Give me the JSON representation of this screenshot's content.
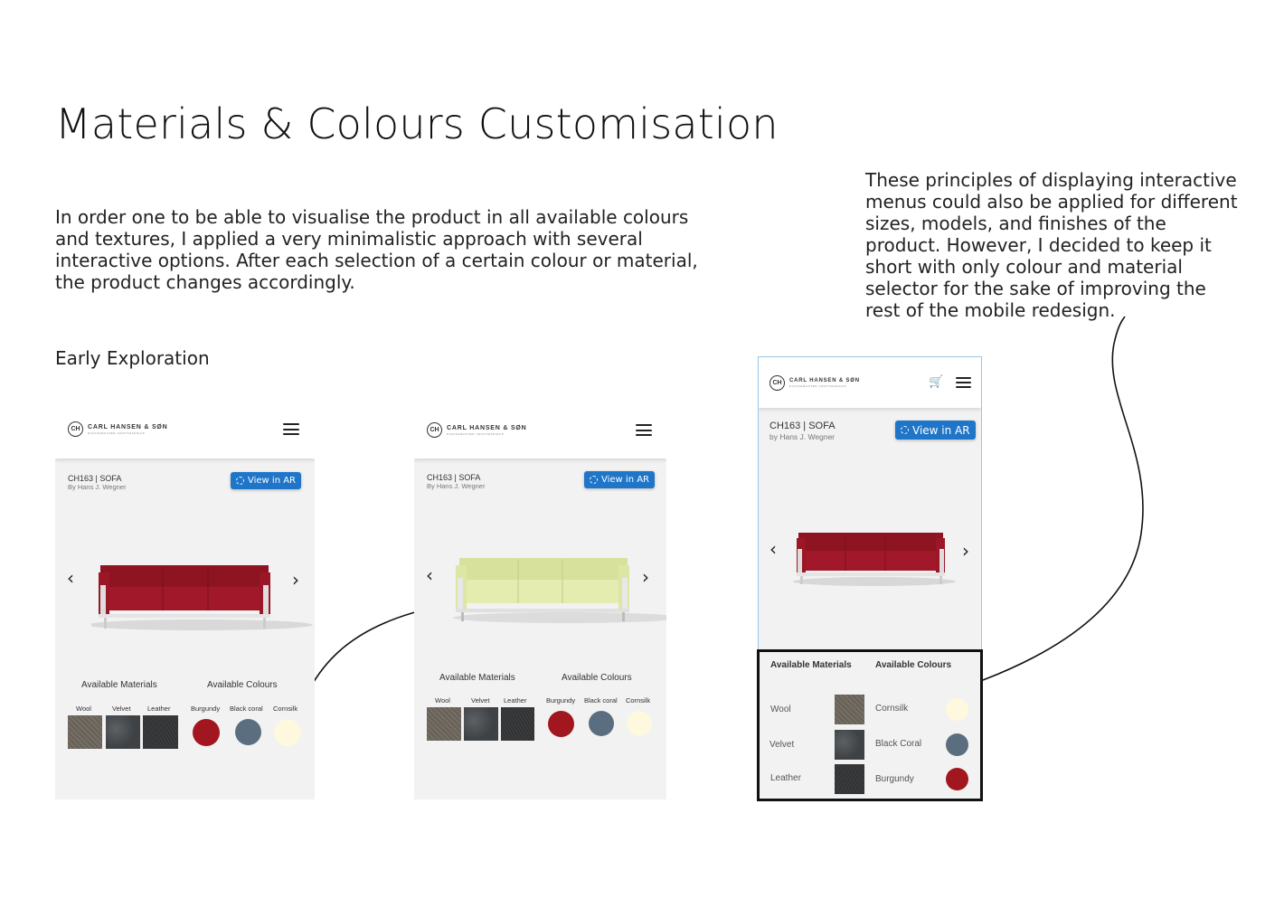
{
  "title": "Materials & Colours Customisation",
  "intro": "In order one to be able to visualise the product in all available colours and textures, I applied a very minimalistic approach with several interactive options. After each selection of a certain colour or material, the product changes accordingly.",
  "side_note": "These principles of displaying interactive menus could also be applied for different sizes, models, and finishes of the product. However, I decided to keep it short with only colour and material selector for the sake of improving the rest of the mobile redesign.",
  "section_label": "Early Exploration",
  "brand": {
    "name": "CARL HANSEN & SØN",
    "tagline": "DANISHMASTER CRAFTMANSHIP",
    "logo_text": "CH"
  },
  "product": {
    "name_small": "CH163 | SOFA",
    "name_large": "CH163 | SOFA",
    "by_small": "By Hans J. Wegner",
    "by_large": "by Hans J. Wegner"
  },
  "ar_label": "View in AR",
  "arrows": {
    "prev": "‹",
    "next": "›"
  },
  "cart_icon": "🛒",
  "options": {
    "materials_heading": "Available Materials",
    "colours_heading": "Available Colours",
    "materials": [
      "Wool",
      "Velvet",
      "Leather"
    ],
    "colours_v1": [
      "Burgundy",
      "Black coral",
      "Cornsilk"
    ],
    "colours_v1_truncated": "Cornsilk",
    "colours_v3": [
      "Cornsilk",
      "Black Coral",
      "Burgundy"
    ]
  },
  "colors": {
    "burgundy": "#a1161f",
    "black_coral": "#5b6e80",
    "cornsilk": "#fdf8de",
    "lime_sofa": "#e4ecb0",
    "ar_blue": "#1f76c8"
  }
}
